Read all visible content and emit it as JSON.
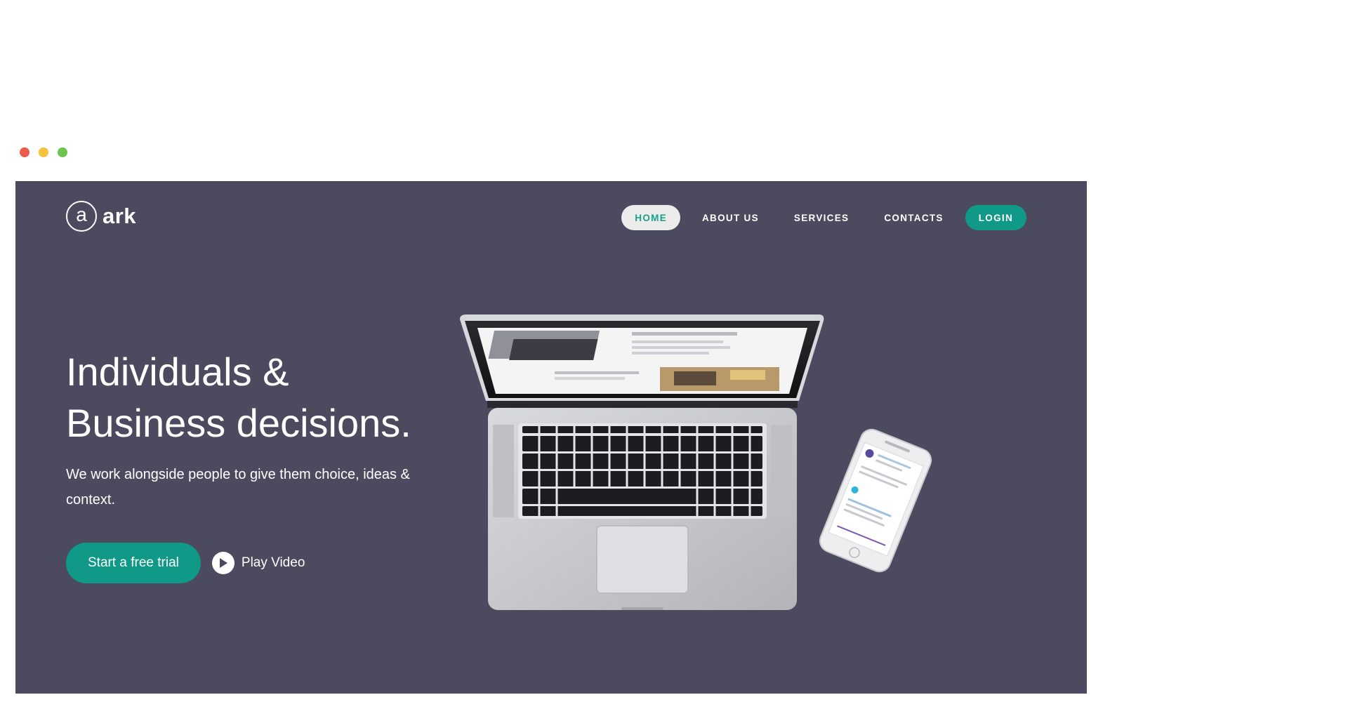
{
  "window": {
    "controls": [
      {
        "name": "close",
        "color": "#ee5b4c"
      },
      {
        "name": "minimize",
        "color": "#f5c33b"
      },
      {
        "name": "maximize",
        "color": "#6cc54f"
      }
    ]
  },
  "brand": {
    "mark": "a",
    "name": "ark"
  },
  "nav": {
    "items": [
      {
        "label": "HOME",
        "active": true
      },
      {
        "label": "ABOUT US",
        "active": false
      },
      {
        "label": "SERVICES",
        "active": false
      },
      {
        "label": "CONTACTS",
        "active": false
      }
    ],
    "login_label": "LOGIN"
  },
  "hero": {
    "headline_line1": "Individuals &",
    "headline_line2": "Business decisions.",
    "subtext": "We work alongside people to give them choice, ideas & context.",
    "cta_label": "Start a free trial",
    "play_label": "Play Video"
  },
  "colors": {
    "hero_bg": "#4b4a5f",
    "accent": "#109987",
    "active_nav_bg": "#ececec",
    "text": "#ffffff"
  },
  "icons": {
    "logo": "circle-a-logo-icon",
    "play": "play-circle-icon",
    "laptop": "laptop-illustration",
    "phone": "smartphone-illustration"
  }
}
